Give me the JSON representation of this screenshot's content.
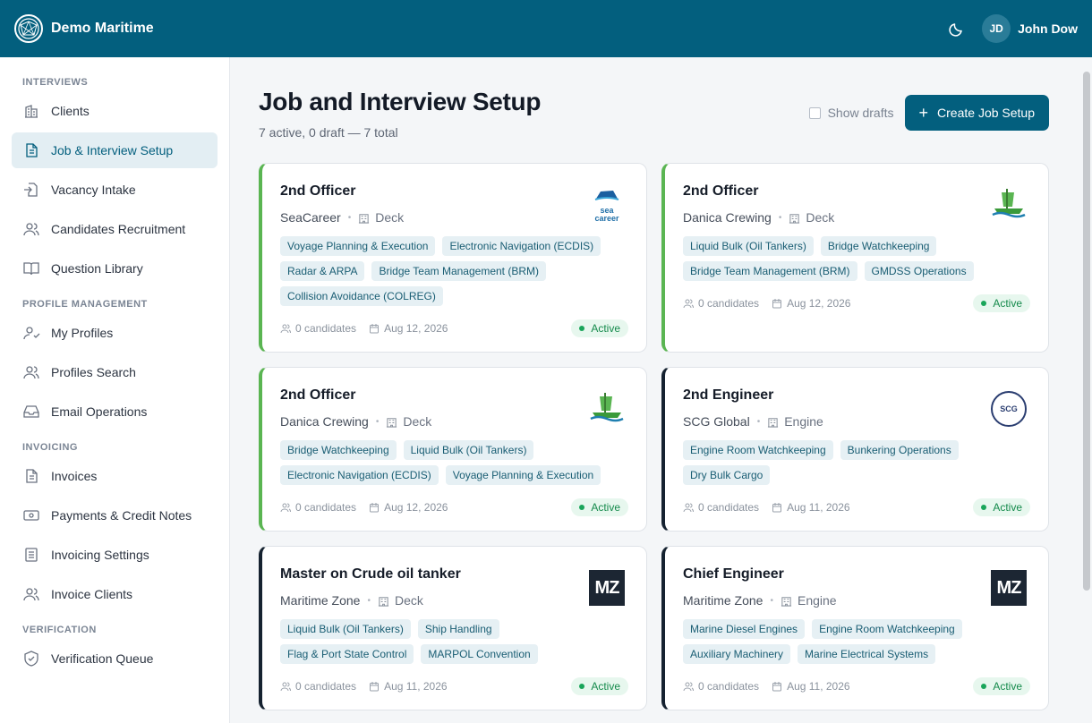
{
  "app": {
    "name": "Demo Maritime"
  },
  "user": {
    "initials": "JD",
    "name": "John Dow"
  },
  "sidebar": {
    "sections": [
      {
        "label": "INTERVIEWS",
        "items": [
          {
            "label": "Clients",
            "icon": "building-icon"
          },
          {
            "label": "Job & Interview Setup",
            "icon": "document-icon",
            "active": true
          },
          {
            "label": "Vacancy Intake",
            "icon": "file-import-icon"
          },
          {
            "label": "Candidates Recruitment",
            "icon": "users-icon"
          },
          {
            "label": "Question Library",
            "icon": "book-icon"
          }
        ]
      },
      {
        "label": "PROFILE MANAGEMENT",
        "items": [
          {
            "label": "My Profiles",
            "icon": "user-check-icon"
          },
          {
            "label": "Profiles Search",
            "icon": "users-icon"
          },
          {
            "label": "Email Operations",
            "icon": "inbox-icon"
          }
        ]
      },
      {
        "label": "INVOICING",
        "items": [
          {
            "label": "Invoices",
            "icon": "document-icon"
          },
          {
            "label": "Payments & Credit Notes",
            "icon": "banknote-icon"
          },
          {
            "label": "Invoicing Settings",
            "icon": "list-icon"
          },
          {
            "label": "Invoice Clients",
            "icon": "users-icon"
          }
        ]
      },
      {
        "label": "VERIFICATION",
        "items": [
          {
            "label": "Verification Queue",
            "icon": "shield-check-icon"
          }
        ]
      }
    ]
  },
  "page": {
    "title": "Job and Interview Setup",
    "summary": "7 active, 0 draft — 7 total",
    "show_drafts_label": "Show drafts",
    "create_label": "Create Job Setup"
  },
  "cards": [
    {
      "title": "2nd Officer",
      "company": "SeaCareer",
      "department": "Deck",
      "logo": "seacareer",
      "tags": [
        "Voyage Planning & Execution",
        "Electronic Navigation (ECDIS)",
        "Radar & ARPA",
        "Bridge Team Management (BRM)",
        "Collision Avoidance (COLREG)"
      ],
      "candidates": "0 candidates",
      "date": "Aug 12, 2026",
      "status": "Active",
      "accent": "#5ab552"
    },
    {
      "title": "2nd Officer",
      "company": "Danica Crewing",
      "department": "Deck",
      "logo": "danica",
      "tags": [
        "Liquid Bulk (Oil Tankers)",
        "Bridge Watchkeeping",
        "Bridge Team Management (BRM)",
        "GMDSS Operations"
      ],
      "candidates": "0 candidates",
      "date": "Aug 12, 2026",
      "status": "Active",
      "accent": "#5ab552"
    },
    {
      "title": "2nd Officer",
      "company": "Danica Crewing",
      "department": "Deck",
      "logo": "danica",
      "tags": [
        "Bridge Watchkeeping",
        "Liquid Bulk (Oil Tankers)",
        "Electronic Navigation (ECDIS)",
        "Voyage Planning & Execution"
      ],
      "candidates": "0 candidates",
      "date": "Aug 12, 2026",
      "status": "Active",
      "accent": "#5ab552"
    },
    {
      "title": "2nd Engineer",
      "company": "SCG Global",
      "department": "Engine",
      "logo": "scg",
      "tags": [
        "Engine Room Watchkeeping",
        "Bunkering Operations",
        "Dry Bulk Cargo"
      ],
      "candidates": "0 candidates",
      "date": "Aug 11, 2026",
      "status": "Active",
      "accent": "#152230"
    },
    {
      "title": "Master on Crude oil tanker",
      "company": "Maritime Zone",
      "department": "Deck",
      "logo": "mz",
      "tags": [
        "Liquid Bulk (Oil Tankers)",
        "Ship Handling",
        "Flag & Port State Control",
        "MARPOL Convention"
      ],
      "candidates": "0 candidates",
      "date": "Aug 11, 2026",
      "status": "Active",
      "accent": "#152230"
    },
    {
      "title": "Chief Engineer",
      "company": "Maritime Zone",
      "department": "Engine",
      "logo": "mz",
      "tags": [
        "Marine Diesel Engines",
        "Engine Room Watchkeeping",
        "Auxiliary Machinery",
        "Marine Electrical Systems"
      ],
      "candidates": "0 candidates",
      "date": "Aug 11, 2026",
      "status": "Active",
      "accent": "#152230"
    }
  ],
  "logo_text": {
    "seacareer": "sea career",
    "scg": "SCG",
    "mz": "MZ"
  },
  "colors": {
    "primary": "#035f7e",
    "accent_green": "#5ab552",
    "accent_dark": "#152230",
    "status_green": "#1aa55a"
  }
}
